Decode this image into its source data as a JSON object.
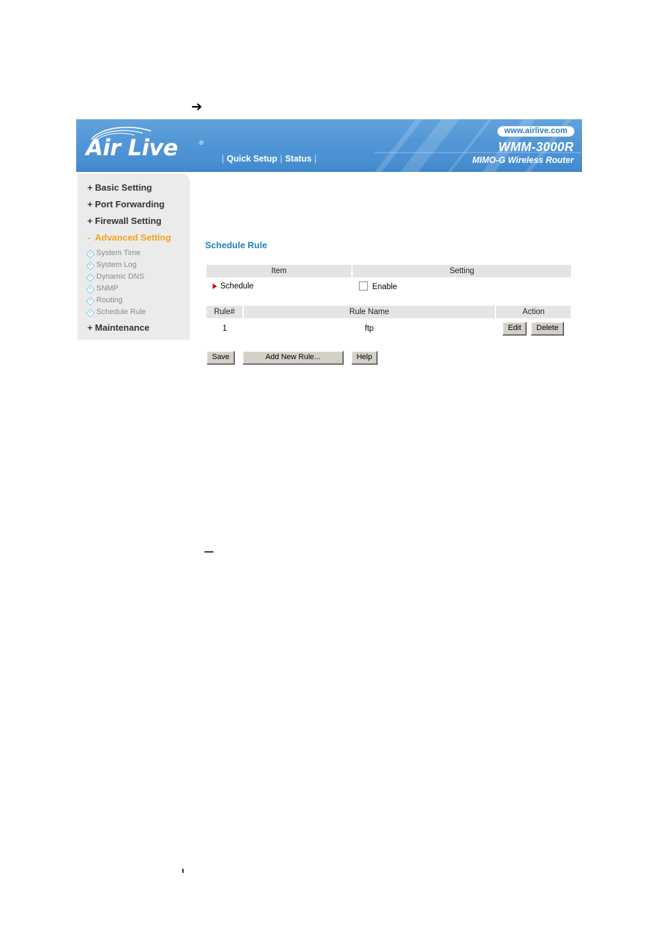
{
  "page": {
    "arrow_marker": "➔",
    "stray_dash": "—",
    "stray_tick": "'"
  },
  "banner": {
    "logo_text": "Air Live",
    "logo_registered": "®",
    "nav": {
      "separator": "|",
      "items": [
        {
          "label": "Quick Setup"
        },
        {
          "label": "Status"
        }
      ]
    },
    "website_url": "www.airlive.com",
    "model": "WMM-3000R",
    "model_subtitle": "MIMO-G Wireless Router",
    "colors": {
      "banner_blue": "#5196d5",
      "url_text": "#2d7dbe"
    }
  },
  "sidebar": {
    "top_items": [
      {
        "prefix": "+",
        "label": "Basic Setting",
        "active": false
      },
      {
        "prefix": "+",
        "label": "Port Forwarding",
        "active": false
      },
      {
        "prefix": "+",
        "label": "Firewall Setting",
        "active": false
      },
      {
        "prefix": "-",
        "label": "Advanced Setting",
        "active": true
      }
    ],
    "sub_items": [
      {
        "label": "System Time"
      },
      {
        "label": "System Log"
      },
      {
        "label": "Dynamic DNS"
      },
      {
        "label": "SNMP"
      },
      {
        "label": "Routing"
      },
      {
        "label": "Schedule Rule"
      }
    ],
    "bottom_item": {
      "prefix": "+",
      "label": "Maintenance"
    },
    "colors": {
      "background": "#ebebeb",
      "active_text": "#f5a21e",
      "sub_text": "#8a8a8a"
    }
  },
  "content": {
    "page_title": "Schedule Rule",
    "page_title_color": "#2182b8",
    "settings_table": {
      "headers": {
        "item": "Item",
        "setting": "Setting"
      },
      "rows": [
        {
          "item_label": "Schedule",
          "checkbox_label": "Enable",
          "checkbox_checked": false
        }
      ]
    },
    "rules_table": {
      "headers": {
        "rule_number": "Rule#",
        "rule_name": "Rule Name",
        "action": "Action"
      },
      "rows": [
        {
          "rule_number": "1",
          "rule_name": "ftp",
          "edit_label": "Edit",
          "delete_label": "Delete"
        }
      ]
    },
    "buttons": {
      "save": "Save",
      "add_new_rule": "Add New Rule...",
      "help": "Help"
    }
  }
}
